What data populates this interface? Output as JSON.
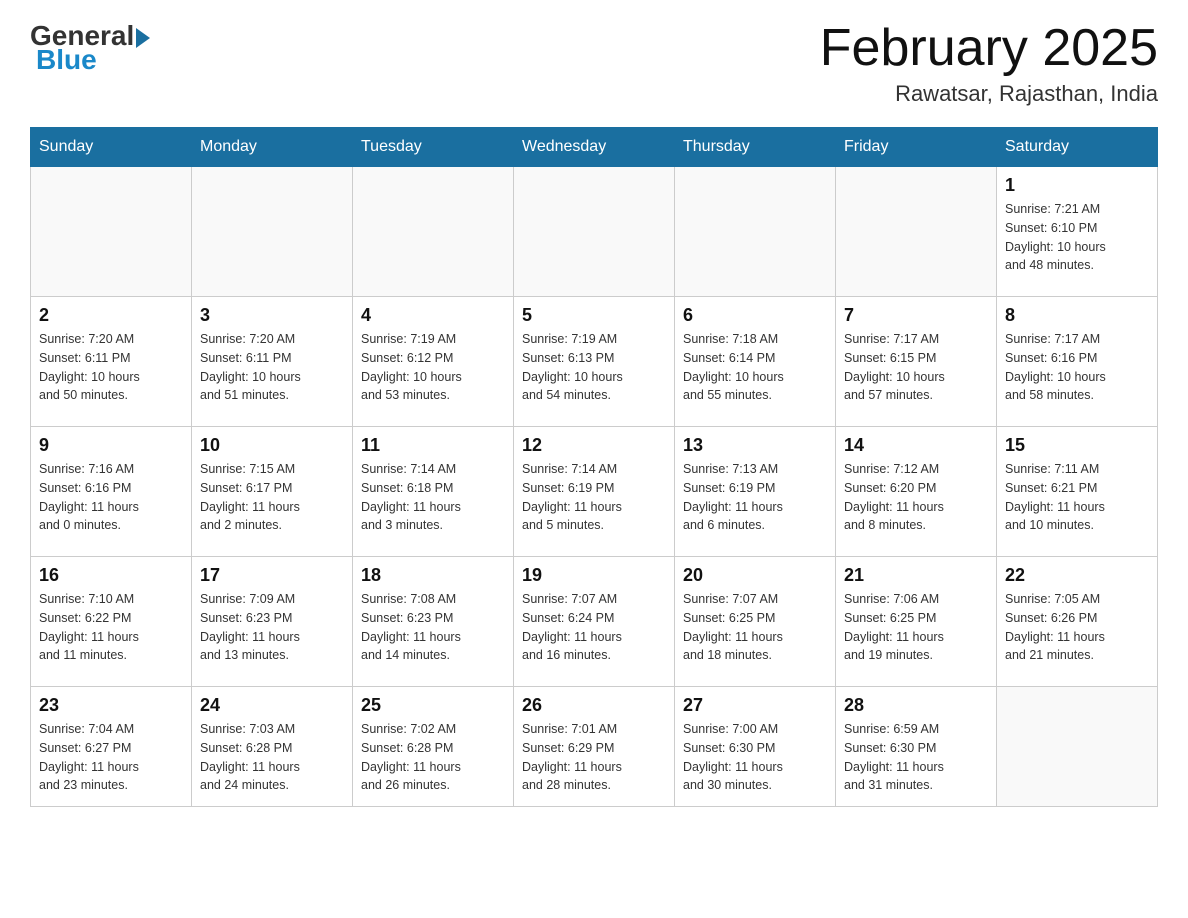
{
  "header": {
    "logo_general": "General",
    "logo_blue": "Blue",
    "month_title": "February 2025",
    "location": "Rawatsar, Rajasthan, India"
  },
  "days_of_week": [
    "Sunday",
    "Monday",
    "Tuesday",
    "Wednesday",
    "Thursday",
    "Friday",
    "Saturday"
  ],
  "weeks": [
    {
      "days": [
        {
          "num": "",
          "info": ""
        },
        {
          "num": "",
          "info": ""
        },
        {
          "num": "",
          "info": ""
        },
        {
          "num": "",
          "info": ""
        },
        {
          "num": "",
          "info": ""
        },
        {
          "num": "",
          "info": ""
        },
        {
          "num": "1",
          "info": "Sunrise: 7:21 AM\nSunset: 6:10 PM\nDaylight: 10 hours\nand 48 minutes."
        }
      ]
    },
    {
      "days": [
        {
          "num": "2",
          "info": "Sunrise: 7:20 AM\nSunset: 6:11 PM\nDaylight: 10 hours\nand 50 minutes."
        },
        {
          "num": "3",
          "info": "Sunrise: 7:20 AM\nSunset: 6:11 PM\nDaylight: 10 hours\nand 51 minutes."
        },
        {
          "num": "4",
          "info": "Sunrise: 7:19 AM\nSunset: 6:12 PM\nDaylight: 10 hours\nand 53 minutes."
        },
        {
          "num": "5",
          "info": "Sunrise: 7:19 AM\nSunset: 6:13 PM\nDaylight: 10 hours\nand 54 minutes."
        },
        {
          "num": "6",
          "info": "Sunrise: 7:18 AM\nSunset: 6:14 PM\nDaylight: 10 hours\nand 55 minutes."
        },
        {
          "num": "7",
          "info": "Sunrise: 7:17 AM\nSunset: 6:15 PM\nDaylight: 10 hours\nand 57 minutes."
        },
        {
          "num": "8",
          "info": "Sunrise: 7:17 AM\nSunset: 6:16 PM\nDaylight: 10 hours\nand 58 minutes."
        }
      ]
    },
    {
      "days": [
        {
          "num": "9",
          "info": "Sunrise: 7:16 AM\nSunset: 6:16 PM\nDaylight: 11 hours\nand 0 minutes."
        },
        {
          "num": "10",
          "info": "Sunrise: 7:15 AM\nSunset: 6:17 PM\nDaylight: 11 hours\nand 2 minutes."
        },
        {
          "num": "11",
          "info": "Sunrise: 7:14 AM\nSunset: 6:18 PM\nDaylight: 11 hours\nand 3 minutes."
        },
        {
          "num": "12",
          "info": "Sunrise: 7:14 AM\nSunset: 6:19 PM\nDaylight: 11 hours\nand 5 minutes."
        },
        {
          "num": "13",
          "info": "Sunrise: 7:13 AM\nSunset: 6:19 PM\nDaylight: 11 hours\nand 6 minutes."
        },
        {
          "num": "14",
          "info": "Sunrise: 7:12 AM\nSunset: 6:20 PM\nDaylight: 11 hours\nand 8 minutes."
        },
        {
          "num": "15",
          "info": "Sunrise: 7:11 AM\nSunset: 6:21 PM\nDaylight: 11 hours\nand 10 minutes."
        }
      ]
    },
    {
      "days": [
        {
          "num": "16",
          "info": "Sunrise: 7:10 AM\nSunset: 6:22 PM\nDaylight: 11 hours\nand 11 minutes."
        },
        {
          "num": "17",
          "info": "Sunrise: 7:09 AM\nSunset: 6:23 PM\nDaylight: 11 hours\nand 13 minutes."
        },
        {
          "num": "18",
          "info": "Sunrise: 7:08 AM\nSunset: 6:23 PM\nDaylight: 11 hours\nand 14 minutes."
        },
        {
          "num": "19",
          "info": "Sunrise: 7:07 AM\nSunset: 6:24 PM\nDaylight: 11 hours\nand 16 minutes."
        },
        {
          "num": "20",
          "info": "Sunrise: 7:07 AM\nSunset: 6:25 PM\nDaylight: 11 hours\nand 18 minutes."
        },
        {
          "num": "21",
          "info": "Sunrise: 7:06 AM\nSunset: 6:25 PM\nDaylight: 11 hours\nand 19 minutes."
        },
        {
          "num": "22",
          "info": "Sunrise: 7:05 AM\nSunset: 6:26 PM\nDaylight: 11 hours\nand 21 minutes."
        }
      ]
    },
    {
      "days": [
        {
          "num": "23",
          "info": "Sunrise: 7:04 AM\nSunset: 6:27 PM\nDaylight: 11 hours\nand 23 minutes."
        },
        {
          "num": "24",
          "info": "Sunrise: 7:03 AM\nSunset: 6:28 PM\nDaylight: 11 hours\nand 24 minutes."
        },
        {
          "num": "25",
          "info": "Sunrise: 7:02 AM\nSunset: 6:28 PM\nDaylight: 11 hours\nand 26 minutes."
        },
        {
          "num": "26",
          "info": "Sunrise: 7:01 AM\nSunset: 6:29 PM\nDaylight: 11 hours\nand 28 minutes."
        },
        {
          "num": "27",
          "info": "Sunrise: 7:00 AM\nSunset: 6:30 PM\nDaylight: 11 hours\nand 30 minutes."
        },
        {
          "num": "28",
          "info": "Sunrise: 6:59 AM\nSunset: 6:30 PM\nDaylight: 11 hours\nand 31 minutes."
        },
        {
          "num": "",
          "info": ""
        }
      ]
    }
  ]
}
